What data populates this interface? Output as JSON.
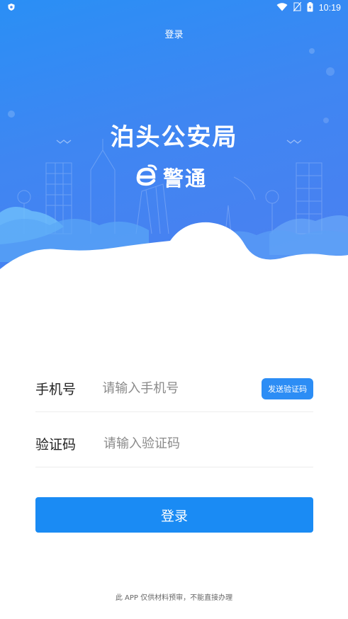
{
  "status_bar": {
    "time": "10:19",
    "icons": [
      "shield-icon",
      "wifi-icon",
      "no-sim-icon",
      "battery-charging-icon"
    ]
  },
  "header": {
    "title": "登录"
  },
  "hero": {
    "app_name": "泊头公安局",
    "brand_name": "警通",
    "brand_logo": "e-logo-icon",
    "colors": {
      "gradient_start": "#2a8ff5",
      "gradient_end": "#4c7ff0"
    }
  },
  "form": {
    "phone_label": "手机号",
    "phone_placeholder": "请输入手机号",
    "phone_value": "",
    "send_code_label": "发送验证码",
    "code_label": "验证码",
    "code_placeholder": "请输入验证码",
    "code_value": ""
  },
  "login_button": {
    "label": "登录",
    "color": "#1a8bf4"
  },
  "footer": {
    "note": "此 APP 仅供材料预审，不能直接办理"
  }
}
